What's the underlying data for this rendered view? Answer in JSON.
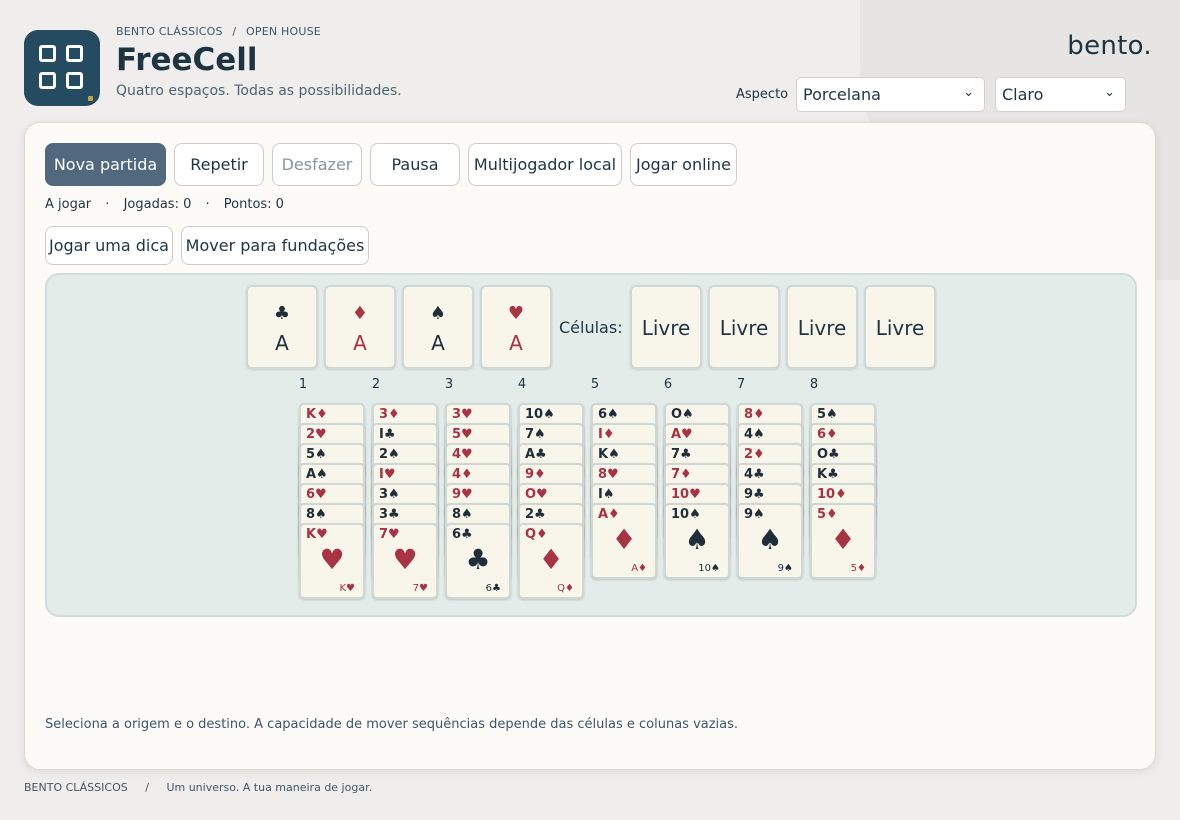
{
  "header": {
    "breadcrumb": [
      "BENTO CLÁSSICOS",
      "/",
      "OPEN HOUSE"
    ],
    "title": "FreeCell",
    "subtitle": "Quatro espaços. Todas as possibilidades.",
    "brand": "bento.",
    "aspect_label": "Aspecto",
    "theme_select": "Porcelana",
    "mode_select": "Claro",
    "icon_name": "grid-app-icon"
  },
  "toolbar": {
    "new_game": "Nova partida",
    "repeat": "Repetir",
    "undo": "Desfazer",
    "pause": "Pausa",
    "local_multi": "Multijogador local",
    "online": "Jogar online",
    "hint": "Jogar uma dica",
    "to_foundations": "Mover para fundações"
  },
  "status": {
    "state": "A jogar",
    "sep": "·",
    "moves": "Jogadas: 0",
    "points": "Pontos: 0"
  },
  "board": {
    "foundations": [
      {
        "suit": "♣",
        "rank": "A",
        "color": "black"
      },
      {
        "suit": "♦",
        "rank": "A",
        "color": "red"
      },
      {
        "suit": "♠",
        "rank": "A",
        "color": "black"
      },
      {
        "suit": "♥",
        "rank": "A",
        "color": "red"
      }
    ],
    "cells_label": "Células:",
    "cells": [
      "Livre",
      "Livre",
      "Livre",
      "Livre"
    ],
    "column_numbers": [
      "1",
      "2",
      "3",
      "4",
      "5",
      "6",
      "7",
      "8"
    ],
    "columns": [
      [
        "K♦",
        "2♥",
        "5♠",
        "A♠",
        "6♥",
        "8♠",
        "K♥"
      ],
      [
        "3♦",
        "I♣",
        "2♠",
        "I♥",
        "3♠",
        "3♣",
        "7♥"
      ],
      [
        "3♥",
        "5♥",
        "4♥",
        "4♦",
        "9♥",
        "8♠",
        "6♣"
      ],
      [
        "10♠",
        "7♠",
        "A♣",
        "9♦",
        "O♥",
        "2♣",
        "Q♦"
      ],
      [
        "6♠",
        "I♦",
        "K♠",
        "8♥",
        "I♠",
        "A♦"
      ],
      [
        "O♠",
        "A♥",
        "7♣",
        "7♦",
        "10♥",
        "10♠"
      ],
      [
        "8♦",
        "4♠",
        "2♦",
        "4♣",
        "9♣",
        "9♠"
      ],
      [
        "5♠",
        "6♦",
        "O♣",
        "K♣",
        "10♦",
        "5♦"
      ]
    ]
  },
  "hint_text": "Seleciona a origem e o destino. A capacidade de mover sequências depende das células e colunas vazias.",
  "footer": {
    "brand": "BENTO CLÁSSICOS",
    "sep": "/",
    "tagline": "Um universo. A tua maneira de jogar."
  }
}
